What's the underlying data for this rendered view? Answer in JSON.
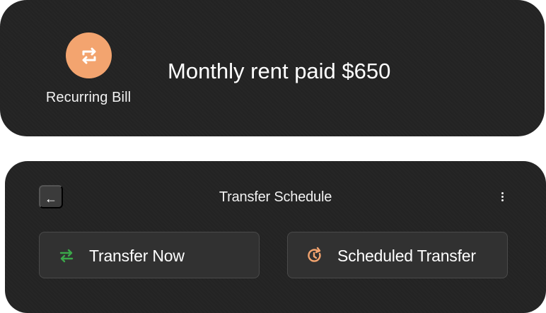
{
  "bill_notification": {
    "icon": "repeat-icon",
    "label": "Recurring Bill",
    "message": "Monthly rent paid $650",
    "accent_color": "#f3a46f"
  },
  "transfer_schedule": {
    "back_icon": "←",
    "title": "Transfer Schedule",
    "more_icon": "more-vertical-icon",
    "actions": [
      {
        "label": "Transfer Now",
        "icon": "transfer-arrows-icon",
        "icon_color": "#3ba84a"
      },
      {
        "label": "Scheduled Transfer",
        "icon": "clock-rotate-icon",
        "icon_color": "#f3a46f"
      }
    ]
  }
}
